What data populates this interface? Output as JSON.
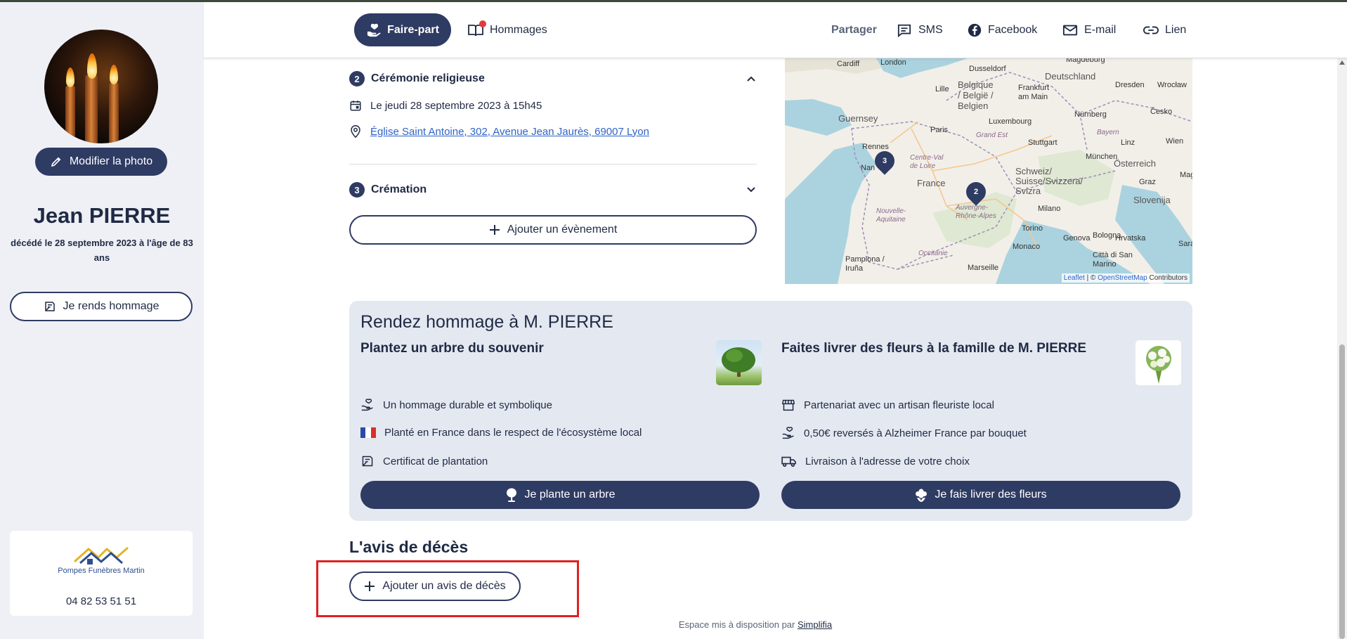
{
  "sidebar": {
    "edit_photo_label": "Modifier la photo",
    "name": "Jean PIERRE",
    "deceased_text": "décédé le 28 septembre 2023 à l'âge de 83 ans",
    "hommage_button_label": "Je rends hommage",
    "agency_name": "Pompes Funèbres Martin",
    "agency_phone": "04 82 53 51 51"
  },
  "header": {
    "tab_faire_part": "Faire-part",
    "tab_hommages": "Hommages",
    "share_label": "Partager",
    "share_sms": "SMS",
    "share_facebook": "Facebook",
    "share_email": "E-mail",
    "share_link": "Lien"
  },
  "events": {
    "step2_number": "2",
    "step2_title": "Cérémonie religieuse",
    "step2_date": "Le jeudi 28 septembre 2023 à 15h45",
    "step2_location": "Église Saint Antoine, 302, Avenue Jean Jaurès, 69007 Lyon",
    "step3_number": "3",
    "step3_title": "Crémation",
    "add_event_label": "Ajouter un évènement"
  },
  "map": {
    "attribution_leaflet": "Leaflet",
    "attribution_sep": " | © ",
    "attribution_osm": "OpenStreetMap",
    "attribution_contrib": " Contributors",
    "labels": {
      "cardiff": "Cardiff",
      "london": "London",
      "dusseldorf": "Dusseldorf",
      "magdeburg": "Magdeburg",
      "belgique": "Belgique / België / Belgien",
      "lille": "Lille",
      "deutschland": "Deutschland",
      "frankfurt": "Frankfurt am Main",
      "dresden": "Dresden",
      "wroclaw": "Wrocław",
      "guernsey": "Guernsey",
      "luxembourg": "Luxembourg",
      "nurnberg": "Nürnberg",
      "cesko": "Česko",
      "paris": "Paris",
      "grandest": "Grand Est",
      "bayern": "Bayern",
      "rennes": "Rennes",
      "stuttgart": "Stuttgart",
      "linz": "Linz",
      "wien": "Wien",
      "munchen": "München",
      "osterreich": "Österreich",
      "centre": "Centre-Val de Loire",
      "nantes": "Nan",
      "schweiz": "Schweiz/ Suisse/Svizzera/ Svizra",
      "france": "France",
      "graz": "Graz",
      "nouvelle": "Nouvelle-Aquitaine",
      "auvergne": "Auvergne-Rhône-Alpes",
      "milano": "Milano",
      "slovenija": "Slovenija",
      "torino": "Torino",
      "hrvatska": "Hrvatska",
      "genova": "Genova",
      "bologna": "Bologna",
      "monaco": "Monaco",
      "occitanie": "Occitanie",
      "pamplona": "Pamplona / Iruña",
      "marseille": "Marseille",
      "sanmarino": "Città di San Marino",
      "sara": "Sara",
      "mag": "Mag"
    },
    "markers": [
      "3",
      "2"
    ]
  },
  "hommage": {
    "title": "Rendez hommage à M. PIERRE",
    "tree": {
      "title": "Plantez un arbre du souvenir",
      "feature1": "Un hommage durable et symbolique",
      "feature2": "Planté en France dans le respect de l'écosystème local",
      "feature3": "Certificat de plantation",
      "button": "Je plante un arbre"
    },
    "flowers": {
      "title": "Faites livrer des fleurs à la famille de M. PIERRE",
      "feature1": "Partenariat avec un artisan fleuriste local",
      "feature2": "0,50€ reversés à Alzheimer France par bouquet",
      "feature3": "Livraison à l'adresse de votre choix",
      "button": "Je fais livrer des fleurs"
    }
  },
  "avis": {
    "title": "L'avis de décès",
    "add_button": "Ajouter un avis de décès"
  },
  "footer": {
    "text": "Espace mis à disposition par ",
    "link": "Simplifia"
  },
  "colors": {
    "primary": "#2e3b63",
    "sidebar_bg": "#eef0f5",
    "panel_bg": "#e4e8f0",
    "highlight": "#e02020",
    "notification_dot": "#e23b3b"
  }
}
